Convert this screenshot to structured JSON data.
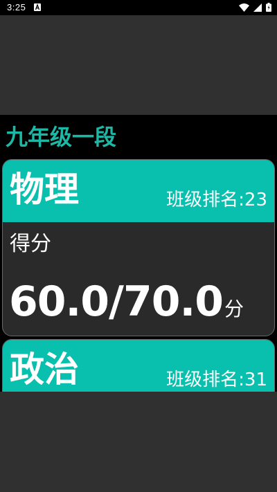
{
  "status_bar": {
    "time": "3:25",
    "icons": [
      "notification-a-icon",
      "wifi-icon",
      "signal-icon",
      "battery-icon"
    ]
  },
  "class_title": "九年级一段",
  "subjects": [
    {
      "name": "物理",
      "rank_label": "班级排名:23",
      "score_label": "得分",
      "score": "60.0/70.0",
      "score_unit": "分"
    },
    {
      "name": "政治",
      "rank_label": "班级排名:31"
    }
  ],
  "colors": {
    "accent": "#09bfae",
    "title": "#1db7a6",
    "card_body": "#2a2a2a",
    "background": "#303030"
  }
}
